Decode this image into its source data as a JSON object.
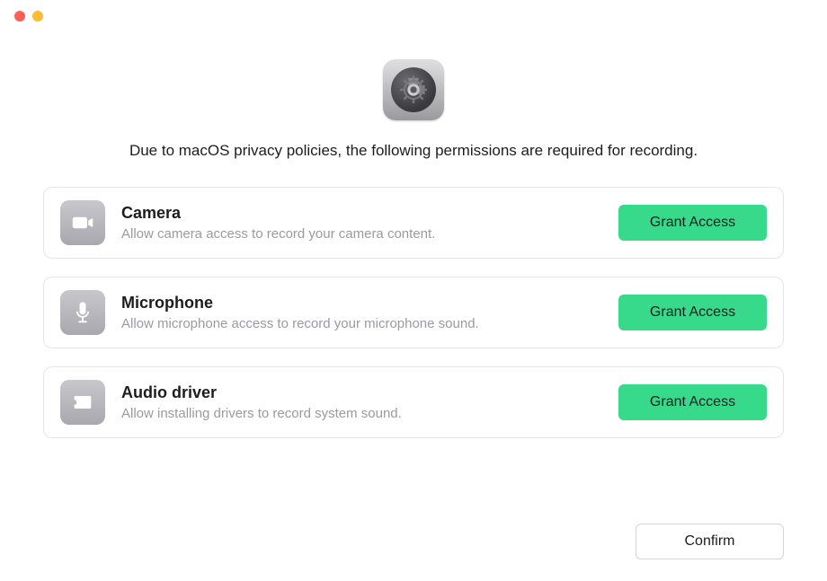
{
  "heading": "Due to macOS privacy policies, the following permissions are required for recording.",
  "permissions": [
    {
      "title": "Camera",
      "desc": "Allow camera access to record your camera content.",
      "button": "Grant Access"
    },
    {
      "title": "Microphone",
      "desc": "Allow microphone access to record your microphone sound.",
      "button": "Grant Access"
    },
    {
      "title": "Audio driver",
      "desc": "Allow installing drivers to record system sound.",
      "button": "Grant Access"
    }
  ],
  "confirm": "Confirm"
}
